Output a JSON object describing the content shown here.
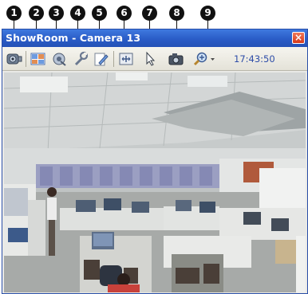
{
  "callouts": [
    "1",
    "2",
    "3",
    "4",
    "5",
    "6",
    "7",
    "8",
    "9"
  ],
  "window": {
    "title": "ShowRoom - Camera 13",
    "close_label": "×"
  },
  "toolbar": {
    "time": "17:43:50",
    "buttons": [
      {
        "name": "camera-select-icon"
      },
      {
        "name": "layout-icon"
      },
      {
        "name": "playback-icon"
      },
      {
        "name": "settings-icon"
      },
      {
        "name": "edit-icon"
      },
      {
        "name": "fit-window-icon"
      },
      {
        "name": "pointer-icon"
      },
      {
        "name": "snapshot-icon"
      },
      {
        "name": "zoom-icon"
      }
    ]
  },
  "colors": {
    "titlebar": "#2a5cc7",
    "close_button": "#d6381a",
    "clock_text": "#2e4da8"
  }
}
